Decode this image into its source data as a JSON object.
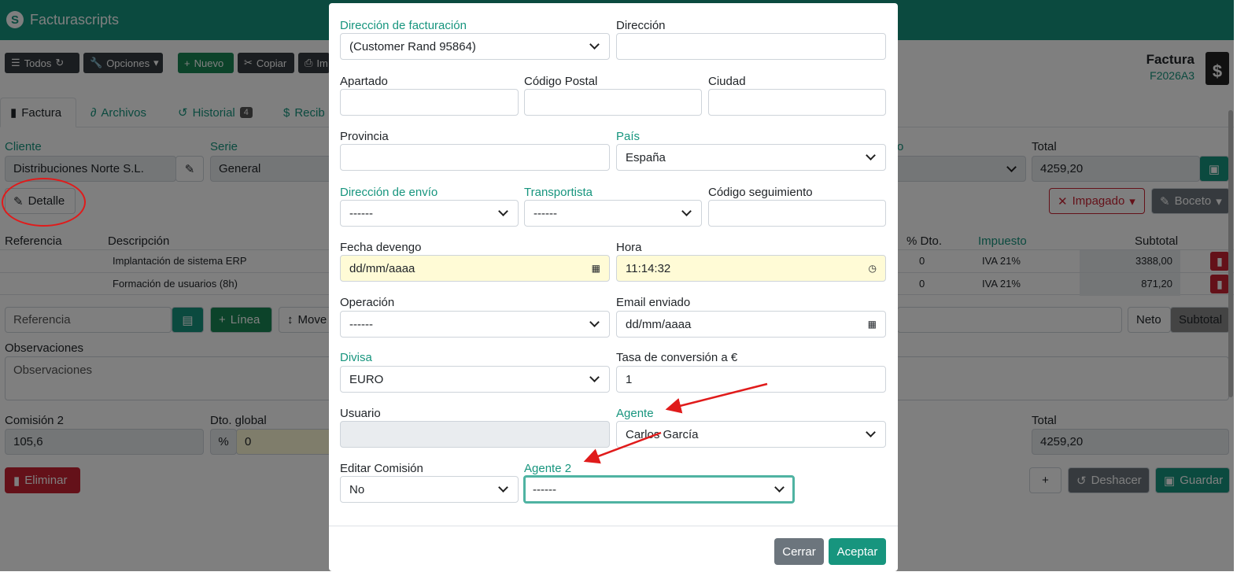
{
  "app": {
    "title": "Facturascripts"
  },
  "toolbar": {
    "all_label": "Todos",
    "options_label": "Opciones",
    "new_label": "Nuevo",
    "copy_label": "Copiar",
    "print_label": "Im"
  },
  "document": {
    "type": "Factura",
    "code": "F2026A3"
  },
  "tabs": [
    {
      "label": "Factura"
    },
    {
      "label": "Archivos"
    },
    {
      "label": "Historial",
      "badge": "4"
    },
    {
      "label": "Recib"
    }
  ],
  "header": {
    "client_label": "Cliente",
    "client_value": "Distribuciones Norte S.L.",
    "series_label": "Serie",
    "series_value": "General",
    "total_label": "Total",
    "total_value": "4259,20",
    "detail_button": "Detalle",
    "unpaid_label": "Impagado",
    "draft_label": "Boceto",
    "partial_label": "o"
  },
  "lines": {
    "headers": [
      "Referencia",
      "Descripción",
      "% Dto.",
      "Impuesto",
      "Subtotal"
    ],
    "rows": [
      {
        "description": "Implantación de sistema ERP",
        "discount": "0",
        "tax": "IVA 21%",
        "subtotal": "3388,00"
      },
      {
        "description": "Formación de usuarios (8h)",
        "discount": "0",
        "tax": "IVA 21%",
        "subtotal": "871,20"
      }
    ],
    "reference_placeholder": "Referencia",
    "add_line_label": "Línea",
    "move_label": "Move",
    "net_label": "Neto",
    "subtotal_label": "Subtotal"
  },
  "footer": {
    "observations_label": "Observaciones",
    "observations_placeholder": "Observaciones",
    "commission_label": "Comisión 2",
    "commission_value": "105,6",
    "discount_label": "Dto. global",
    "discount_value": "0",
    "discount_unit": "%",
    "total_label": "Total",
    "total_value": "4259,20",
    "delete_label": "Eliminar",
    "undo_label": "Deshacer",
    "save_label": "Guardar"
  },
  "modal": {
    "billing_address_label": "Dirección de facturación",
    "billing_address_value": "(Customer Rand 95864)",
    "address_label": "Dirección",
    "address_value": "",
    "po_box_label": "Apartado",
    "po_box_value": "",
    "postal_code_label": "Código Postal",
    "postal_code_value": "",
    "city_label": "Ciudad",
    "city_value": "",
    "province_label": "Provincia",
    "province_value": "",
    "country_label": "País",
    "country_value": "España",
    "shipping_address_label": "Dirección de envío",
    "shipping_address_value": "------",
    "carrier_label": "Transportista",
    "carrier_value": "------",
    "tracking_label": "Código seguimiento",
    "tracking_value": "",
    "accrual_date_label": "Fecha devengo",
    "accrual_date_value": "dd/mm/aaaa",
    "time_label": "Hora",
    "time_value": "11:14:32",
    "operation_label": "Operación",
    "operation_value": "------",
    "email_sent_label": "Email enviado",
    "email_sent_value": "dd/mm/aaaa",
    "currency_label": "Divisa",
    "currency_value": "EURO",
    "conversion_label": "Tasa de conversión a €",
    "conversion_value": "1",
    "user_label": "Usuario",
    "user_value": "",
    "agent_label": "Agente",
    "agent_value": "Carlos García",
    "edit_commission_label": "Editar Comisión",
    "edit_commission_value": "No",
    "agent2_label": "Agente 2",
    "agent2_value": "------",
    "close_label": "Cerrar",
    "accept_label": "Aceptar"
  },
  "colors": {
    "brand": "#17957e",
    "annotation": "#e01b1b",
    "accent_label": "#17957e",
    "focus_border": "#4fb3a2",
    "date_field_bg": "#fffbd6"
  }
}
